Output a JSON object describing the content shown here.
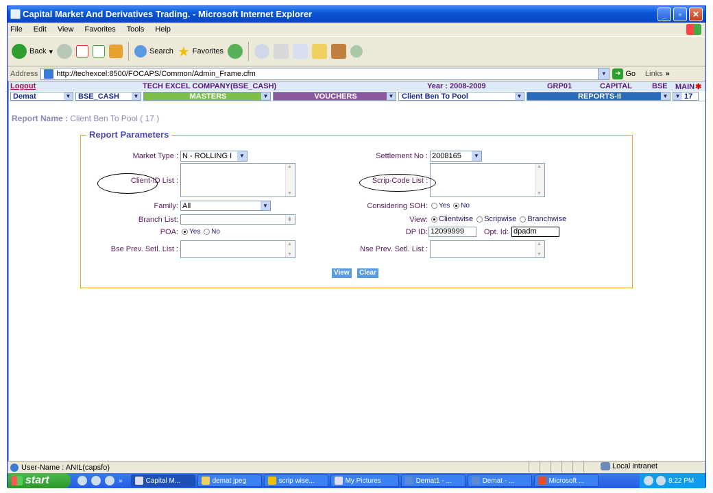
{
  "window": {
    "title": "Capital Market And Derivatives Trading. - Microsoft Internet Explorer"
  },
  "menu": [
    "File",
    "Edit",
    "View",
    "Favorites",
    "Tools",
    "Help"
  ],
  "toolbar": {
    "back": "Back",
    "search": "Search",
    "favorites": "Favorites"
  },
  "address": {
    "label": "Address",
    "url": "http://techexcel:8500/FOCAPS/Common/Admin_Frame.cfm",
    "go": "Go",
    "links": "Links"
  },
  "header": {
    "logout": "Logout",
    "company": "TECH EXCEL COMPANY(BSE_CASH)",
    "year": "Year :  2008-2009",
    "group": "GRP01",
    "capital": "CAPITAL",
    "bse": "BSE",
    "main": "MAIN"
  },
  "nav": {
    "demat": "Demat",
    "bse_cash": "BSE_CASH",
    "masters": "MASTERS",
    "vouchers": "VOUCHERS",
    "client_ben": "Client Ben To Pool",
    "reports": "REPORTS-II",
    "num": "17"
  },
  "report": {
    "label": "Report Name :",
    "name": "Client Ben To Pool ( 17 )",
    "legend": "Report Parameters"
  },
  "form": {
    "market_type_label": "Market Type :",
    "market_type_value": "N - ROLLING I",
    "settlement_label": "Settlement No :",
    "settlement_value": "2008165",
    "client_id_label": "Client-ID List :",
    "scrip_code_label": "Scrip-Code List :",
    "family_label": "Family:",
    "family_value": "All",
    "soh_label": "Considering SOH:",
    "soh_yes": "Yes",
    "soh_no": "No",
    "branch_label": "Branch List:",
    "view_label": "View:",
    "view_clientwise": "Clientwise",
    "view_scripwise": "Scripwise",
    "view_branchwise": "Branchwise",
    "poa_label": "POA:",
    "poa_yes": "Yes",
    "poa_no": "No",
    "dpid_label": "DP ID:",
    "dpid_value": "12099999",
    "optid_label": "Opt. Id:",
    "optid_value": "dpadm",
    "bse_prev_label": "Bse Prev. Setl. List :",
    "nse_prev_label": "Nse Prev. Setl. List :",
    "view_button": "View",
    "clear_button": "Clear"
  },
  "status": {
    "user": "User-Name : ANIL(capsfo)",
    "zone": "Local intranet"
  },
  "taskbar": {
    "start": "start",
    "tasks": [
      "Capital M...",
      "demat jpeg",
      "scrip wise...",
      "My Pictures",
      "Demat1 - ...",
      "Demat - ...",
      "Microsoft ..."
    ],
    "time": "8:22 PM"
  }
}
